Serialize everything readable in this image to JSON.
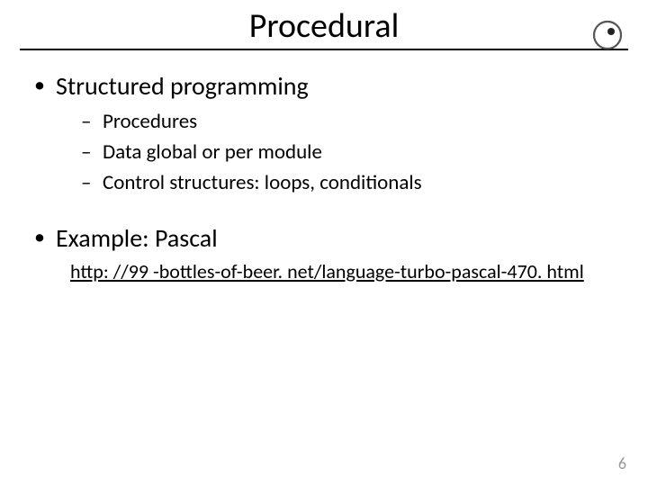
{
  "title": "Procedural",
  "bullets": {
    "main1": "Structured programming",
    "sub": [
      "Procedures",
      "Data global or per module",
      "Control structures: loops,  conditionals"
    ],
    "main2": "Example: Pascal",
    "link": "http: //99 -bottles-of-beer. net/language-turbo-pascal-470. html"
  },
  "page_number": "6"
}
